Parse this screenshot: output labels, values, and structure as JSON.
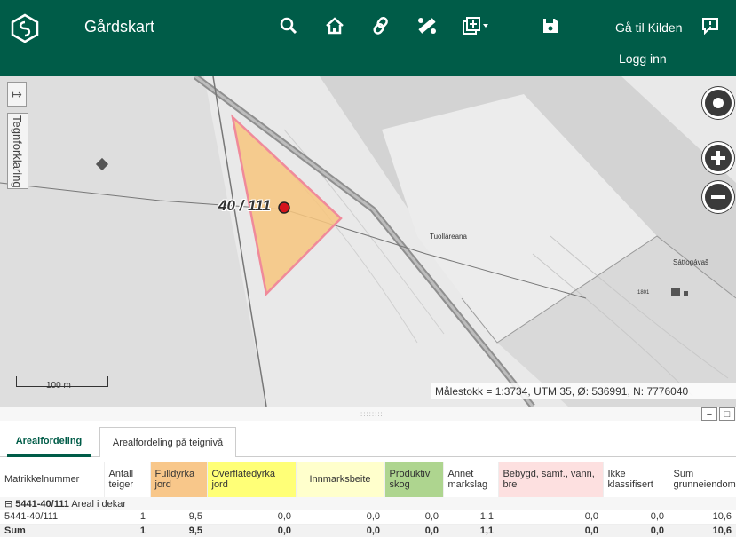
{
  "header": {
    "title": "Gårdskart",
    "link_source": "Gå til Kilden",
    "link_login": "Logg inn"
  },
  "toolbar_icons": [
    "search-icon",
    "home-icon",
    "link-icon",
    "measure-icon",
    "layers-add-icon",
    "save-icon",
    "feedback-icon"
  ],
  "map": {
    "legend_label": "Tegnforklaring",
    "parcel_label": "40 / 111",
    "place_tuollareana": "Tuolláreana",
    "place_sattogavas": "Sáttogávaš",
    "house_number": "1801",
    "scale_label": "100 m",
    "status_text": "Målestokk = 1:3734, UTM 35,  Ø:  536991, N: 7776040",
    "parcel_color": "#f7c57e",
    "parcel_border": "#f08a9a"
  },
  "tabs": [
    {
      "label": "Arealfordeling"
    },
    {
      "label": "Arealfordeling på teignivå"
    }
  ],
  "table": {
    "headers": [
      "Matrikkelnummer",
      "Antall teiger",
      "Fulldyrka jord",
      "Overflatedyrka jord",
      "Innmarksbeite",
      "Produktiv skog",
      "Annet markslag",
      "Bebygd, samf., vann, bre",
      "Ikke klassifisert",
      "Sum grunneiendom"
    ],
    "header_colors": [
      "#ffffff",
      "#ffffff",
      "#f8c78a",
      "#ffff77",
      "#ffffcc",
      "#aed58f",
      "#ffffff",
      "#fde0e0",
      "#ffffff",
      "#ffffff"
    ],
    "group_id": "5441-40/111",
    "group_suffix": "Areal i dekar",
    "rows": [
      [
        "5441-40/111",
        "1",
        "9,5",
        "0,0",
        "0,0",
        "0,0",
        "1,1",
        "0,0",
        "0,0",
        "10,6"
      ]
    ],
    "sum_row": [
      "Sum",
      "1",
      "9,5",
      "0,0",
      "0,0",
      "0,0",
      "1,1",
      "0,0",
      "0,0",
      "10,6"
    ]
  }
}
